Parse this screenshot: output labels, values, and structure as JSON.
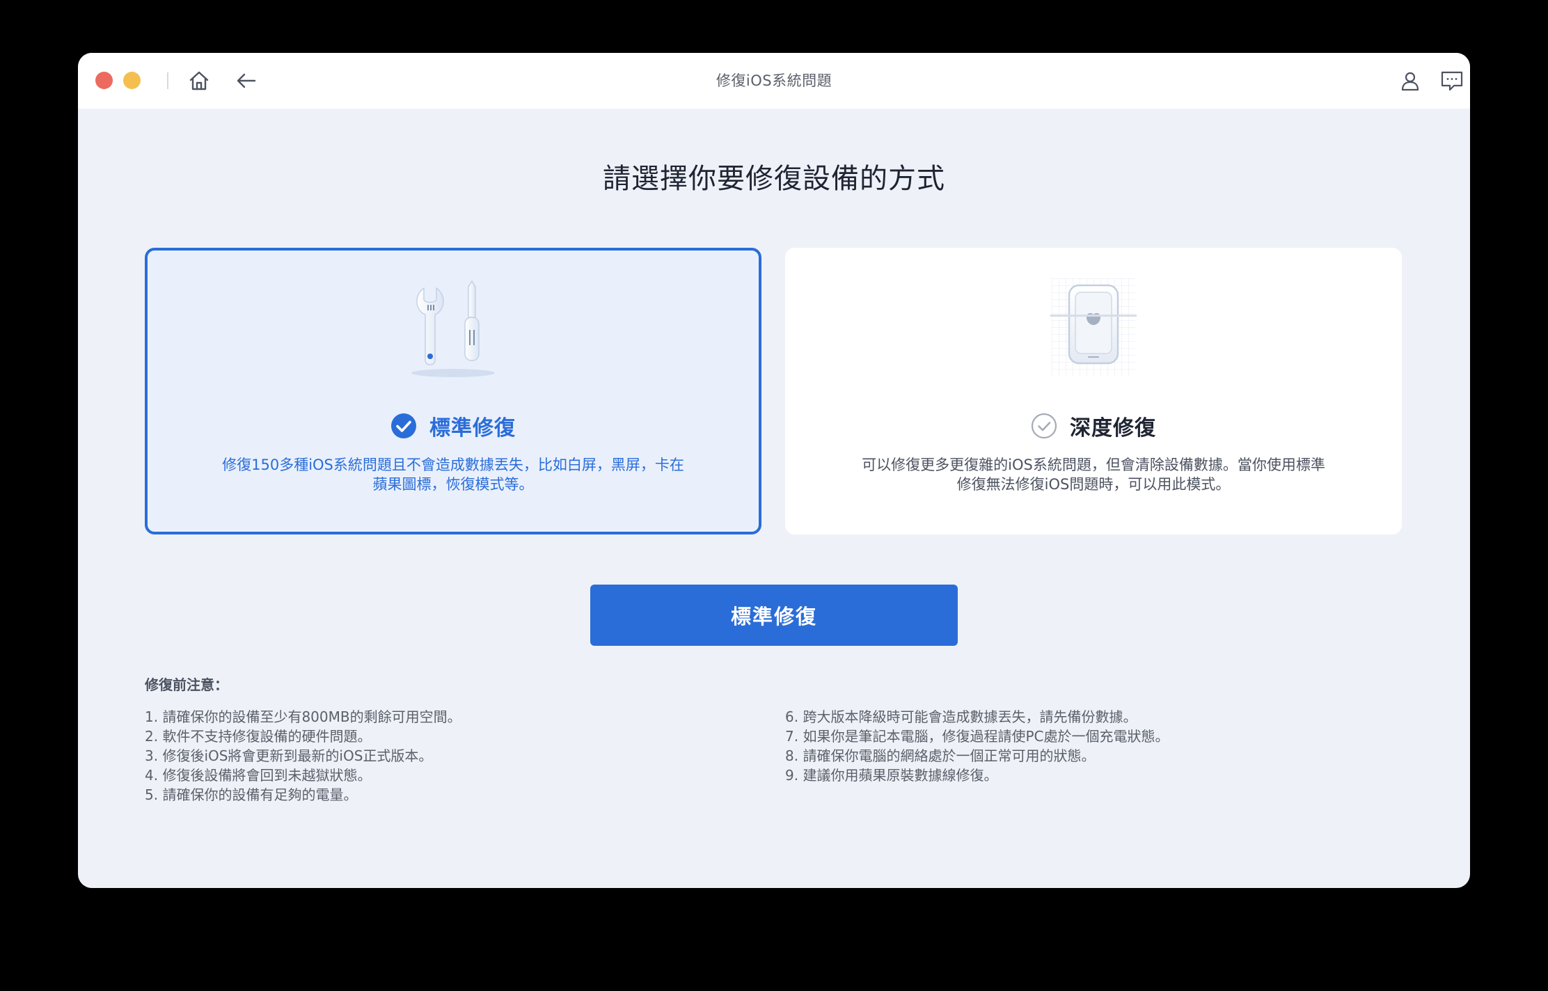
{
  "window": {
    "title": "修復iOS系統問題"
  },
  "page": {
    "heading": "請選擇你要修復設備的方式"
  },
  "modes": [
    {
      "name": "標準修復",
      "description": "修復150多種iOS系統問題且不會造成數據丟失，比如白屏，黑屏，卡在蘋果圖標，恢復模式等。",
      "selected": true,
      "icon": "wrench-screwdriver-icon"
    },
    {
      "name": "深度修復",
      "description": "可以修復更多更復雜的iOS系統問題，但會清除設備數據。當你使用標準修復無法修復iOS問題時，可以用此模式。",
      "selected": false,
      "icon": "phone-scan-icon"
    }
  ],
  "action": {
    "button_label": "標準修復"
  },
  "notes": {
    "title": "修復前注意：",
    "left": [
      "1. 請確保你的設備至少有800MB的剩餘可用空間。",
      "2. 軟件不支持修復設備的硬件問題。",
      "3. 修復後iOS將會更新到最新的iOS正式版本。",
      "4. 修復後設備將會回到未越獄狀態。",
      "5. 請確保你的設備有足夠的電量。"
    ],
    "right": [
      "6. 跨大版本降級時可能會造成數據丟失，請先備份數據。",
      "7. 如果你是筆記本電腦，修復過程請使PC處於一個充電狀態。",
      "8. 請確保你電腦的網絡處於一個正常可用的狀態。",
      "9. 建議你用蘋果原裝數據線修復。"
    ]
  },
  "colors": {
    "accent": "#2a6dd8",
    "background": "#eef2f8",
    "selected_card": "#e9f0fc"
  }
}
